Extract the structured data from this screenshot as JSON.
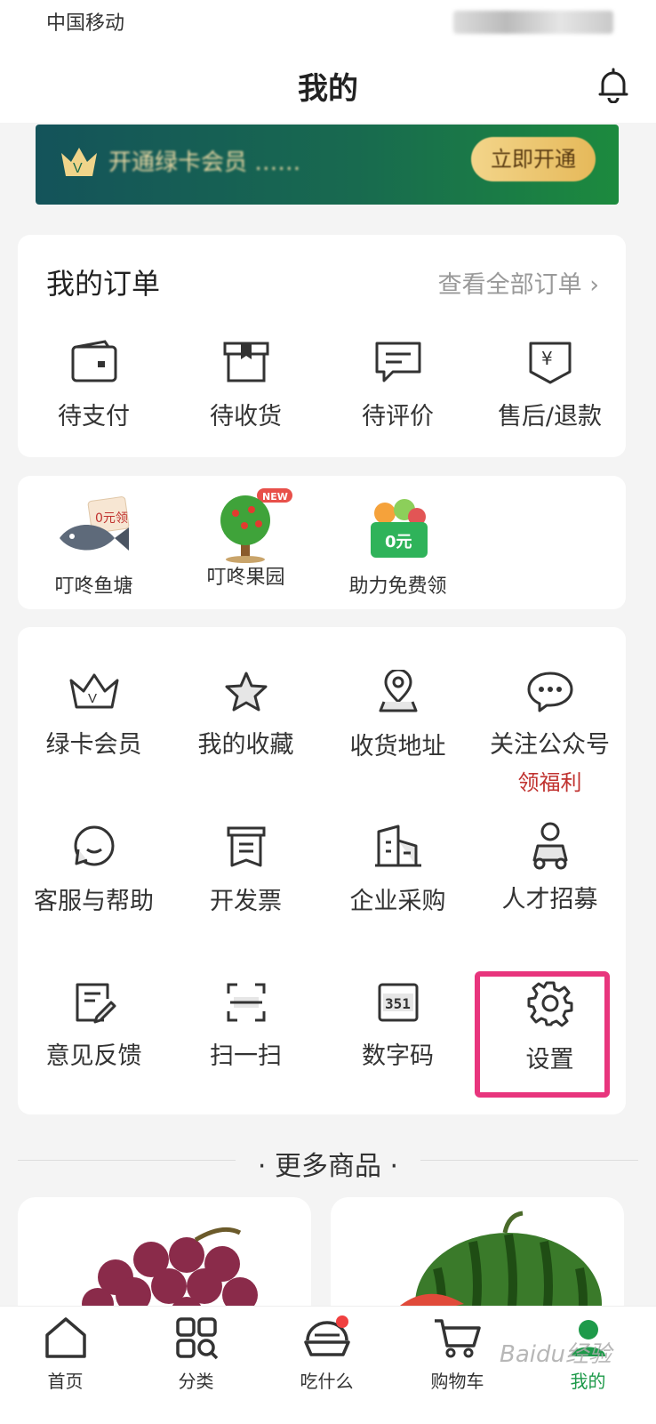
{
  "status_bar": {
    "carrier": "中国移动"
  },
  "header": {
    "title": "我的"
  },
  "banner": {
    "text": "开通绿卡会员 ……",
    "button": "立即开通"
  },
  "orders": {
    "title": "我的订单",
    "see_all": "查看全部订单",
    "items": [
      {
        "label": "待支付",
        "icon": "wallet-icon"
      },
      {
        "label": "待收货",
        "icon": "package-icon"
      },
      {
        "label": "待评价",
        "icon": "comment-icon"
      },
      {
        "label": "售后/退款",
        "icon": "refund-icon"
      }
    ]
  },
  "promos": {
    "items": [
      {
        "label": "叮咚鱼塘",
        "badge": "0元领",
        "icon": "fish-icon"
      },
      {
        "label": "叮咚果园",
        "badge": "NEW",
        "icon": "tree-icon"
      },
      {
        "label": "助力免费领",
        "badge": "0元",
        "icon": "basket-icon"
      }
    ]
  },
  "services": {
    "items": [
      {
        "label": "绿卡会员",
        "icon": "crown-icon"
      },
      {
        "label": "我的收藏",
        "icon": "star-icon"
      },
      {
        "label": "收货地址",
        "icon": "location-icon"
      },
      {
        "label": "关注公众号",
        "sub": "领福利",
        "icon": "chat-icon"
      },
      {
        "label": "客服与帮助",
        "icon": "service-icon"
      },
      {
        "label": "开发票",
        "icon": "invoice-icon"
      },
      {
        "label": "企业采购",
        "icon": "building-icon"
      },
      {
        "label": "人才招募",
        "icon": "courier-icon"
      },
      {
        "label": "意见反馈",
        "icon": "feedback-icon"
      },
      {
        "label": "扫一扫",
        "icon": "scan-icon"
      },
      {
        "label": "数字码",
        "icon_text": "351",
        "icon": "digital-code-icon"
      },
      {
        "label": "设置",
        "icon": "gear-icon"
      }
    ]
  },
  "more": {
    "title": "更多商品"
  },
  "tabbar": {
    "items": [
      {
        "label": "首页",
        "icon": "home-icon"
      },
      {
        "label": "分类",
        "icon": "category-icon"
      },
      {
        "label": "吃什么",
        "icon": "food-icon"
      },
      {
        "label": "购物车",
        "icon": "cart-icon"
      },
      {
        "label": "我的",
        "icon": "profile-icon"
      }
    ]
  },
  "watermark": "Baidu经验",
  "colors": {
    "accent": "#1e9a4a",
    "highlight": "#e8357d",
    "promo_red": "#c0322f"
  }
}
